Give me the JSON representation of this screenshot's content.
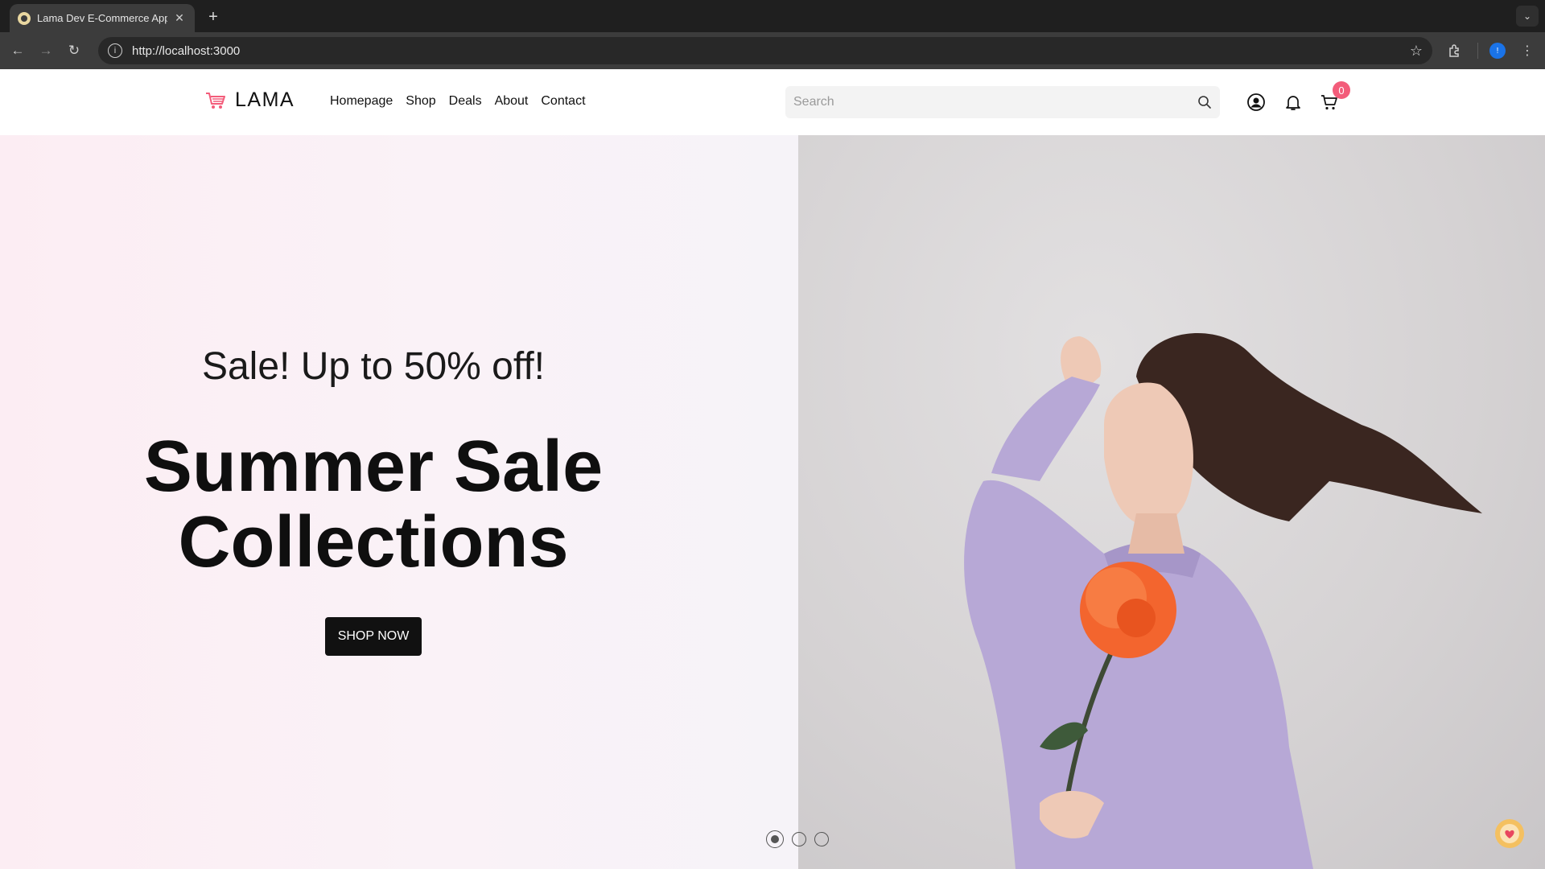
{
  "browser": {
    "tab_title": "Lama Dev E-Commerce Appl",
    "url": "http://localhost:3000",
    "profile_initial": "!"
  },
  "site": {
    "logo_text": "LAMA",
    "menu": [
      {
        "label": "Homepage"
      },
      {
        "label": "Shop"
      },
      {
        "label": "Deals"
      },
      {
        "label": "About"
      },
      {
        "label": "Contact"
      }
    ],
    "search_placeholder": "Search",
    "cart_count": "0",
    "colors": {
      "accent": "#f35c7a",
      "button": "#111111"
    }
  },
  "hero": {
    "subtitle": "Sale! Up to 50% off!",
    "title_line1": "Summer Sale",
    "title_line2": "Collections",
    "cta_label": "SHOP NOW",
    "slides_total": 3,
    "active_slide": 1
  }
}
